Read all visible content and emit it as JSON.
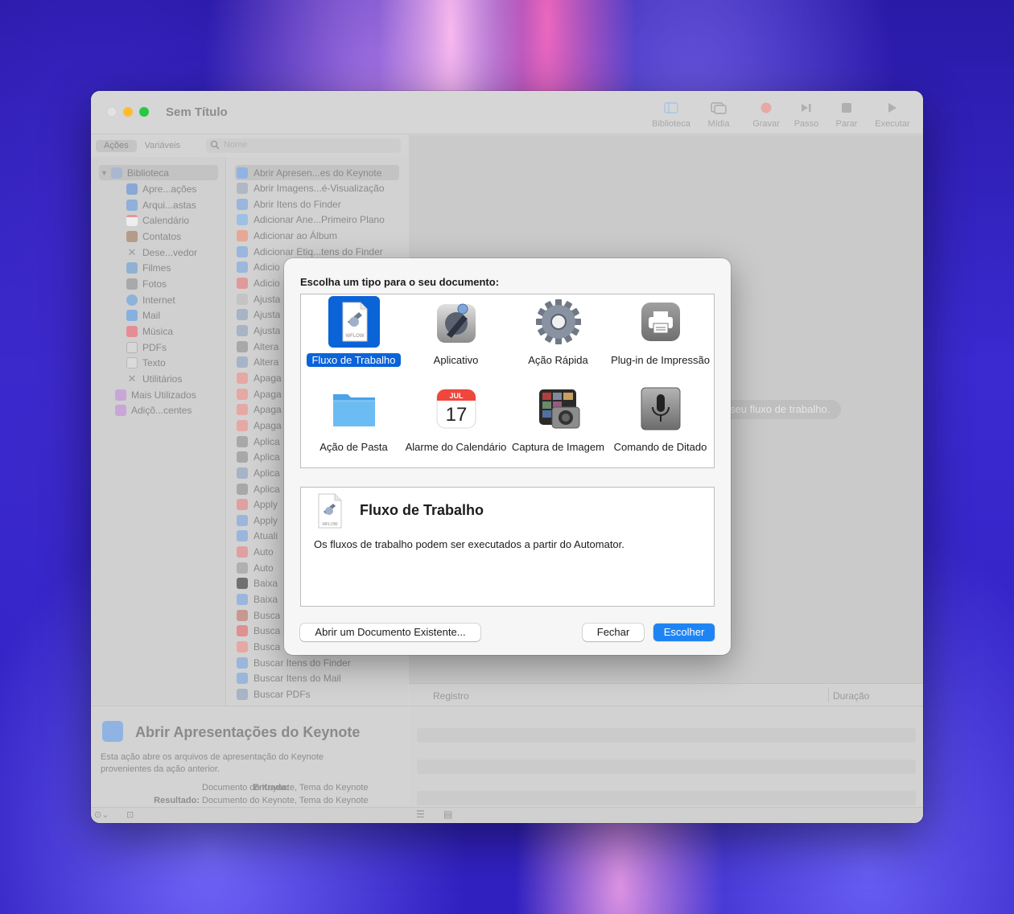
{
  "window": {
    "title": "Sem Título"
  },
  "toolbar": {
    "library": "Biblioteca",
    "media": "Mídia",
    "record": "Gravar",
    "step": "Passo",
    "stop": "Parar",
    "run": "Executar"
  },
  "library_tabs": {
    "actions": "Ações",
    "variables": "Variáveis"
  },
  "search": {
    "placeholder": "Nome"
  },
  "sidebar": {
    "items": [
      "Biblioteca",
      "Apre...ações",
      "Arqui...astas",
      "Calendário",
      "Contatos",
      "Dese...vedor",
      "Filmes",
      "Fotos",
      "Internet",
      "Mail",
      "Música",
      "PDFs",
      "Texto",
      "Utilitários",
      "Mais Utilizados",
      "Adiçõ...centes"
    ]
  },
  "actions": {
    "items": [
      "Abrir Apresen...es do Keynote",
      "Abrir Imagens...é-Visualização",
      "Abrir Itens do Finder",
      "Adicionar Ane...Primeiro Plano",
      "Adicionar ao Álbum",
      "Adicionar Etiq...tens do Finder",
      "Adicio",
      "Adicio",
      "Ajusta",
      "Ajusta",
      "Ajusta",
      "Altera",
      "Altera",
      "Apaga",
      "Apaga",
      "Apaga",
      "Apaga",
      "Aplica",
      "Aplica",
      "Aplica",
      "Aplica",
      "Apply",
      "Apply",
      "Atuali",
      "Auto",
      "Auto",
      "Baixa",
      "Baixa",
      "Busca",
      "Busca",
      "Busca",
      "Buscar Itens do Finder",
      "Buscar Itens do Mail",
      "Buscar PDFs"
    ]
  },
  "canvas": {
    "hint": "seu fluxo de trabalho."
  },
  "log": {
    "col_log": "Registro",
    "col_duration": "Duração"
  },
  "description": {
    "title": "Abrir Apresentações do Keynote",
    "text": "Esta ação abre os arquivos de apresentação do Keynote provenientes da ação anterior.",
    "input_label": "Entrada:",
    "input_value": "Documento do Keynote, Tema do Keynote",
    "result_label": "Resultado:",
    "result_value": "Documento do Keynote, Tema do Keynote"
  },
  "dialog": {
    "prompt": "Escolha um tipo para o seu documento:",
    "types": [
      {
        "label": "Fluxo de Trabalho",
        "icon": "workflow-icon",
        "selected": true
      },
      {
        "label": "Aplicativo",
        "icon": "application-icon"
      },
      {
        "label": "Ação Rápida",
        "icon": "gear-icon"
      },
      {
        "label": "Plug-in de Impressão",
        "icon": "printer-icon"
      },
      {
        "label": "Ação de Pasta",
        "icon": "folder-icon"
      },
      {
        "label": "Alarme do Calendário",
        "icon": "calendar-icon"
      },
      {
        "label": "Captura de Imagem",
        "icon": "camera-icon"
      },
      {
        "label": "Comando de Ditado",
        "icon": "microphone-icon"
      }
    ],
    "calendar_month": "JUL",
    "calendar_day": "17",
    "wflow_tag": "WFLOW",
    "info": {
      "title": "Fluxo de Trabalho",
      "text": "Os fluxos de trabalho podem ser executados a partir do Automator."
    },
    "buttons": {
      "open": "Abrir um Documento Existente...",
      "close": "Fechar",
      "choose": "Escolher"
    }
  },
  "colors": {
    "accent": "#0b63d8",
    "primary_button": "#1f84f3",
    "close": "#ff5f57",
    "minimize": "#febc2e",
    "zoom": "#28c840"
  }
}
